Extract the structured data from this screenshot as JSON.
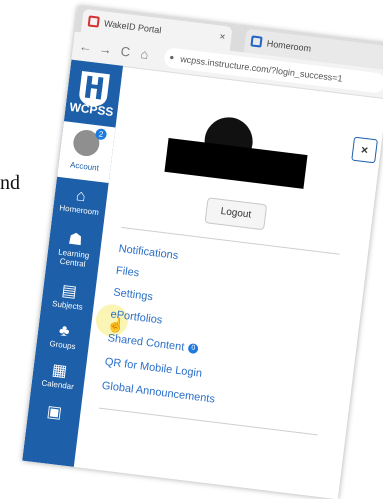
{
  "background_text": "nd",
  "browser": {
    "tabs": [
      {
        "title": "WakeID Portal",
        "close": "×"
      },
      {
        "title": "Homeroom"
      }
    ],
    "nav": {
      "back": "←",
      "forward": "→",
      "reload": "C",
      "home": "⌂"
    },
    "address": "wcpss.instructure.com/?login_success=1"
  },
  "sidebar": {
    "logo_text": "WCPSS",
    "account": {
      "label": "Account",
      "badge": "2"
    },
    "items": [
      {
        "label": "Homeroom",
        "icon": "home-icon",
        "glyph": "⌂"
      },
      {
        "label": "Learning Central",
        "icon": "people-icon",
        "glyph": "☗"
      },
      {
        "label": "Subjects",
        "icon": "book-icon",
        "glyph": "▤"
      },
      {
        "label": "Groups",
        "icon": "groups-icon",
        "glyph": "♣"
      },
      {
        "label": "Calendar",
        "icon": "calendar-icon",
        "glyph": "▦"
      },
      {
        "label": "",
        "icon": "inbox-icon",
        "glyph": "▣"
      }
    ]
  },
  "account_panel": {
    "close": "×",
    "logout_label": "Logout",
    "links": [
      {
        "label": "Notifications"
      },
      {
        "label": "Files"
      },
      {
        "label": "Settings"
      },
      {
        "label": "ePortfolios"
      },
      {
        "label": "Shared Content",
        "badge": "0"
      },
      {
        "label": "QR for Mobile Login"
      },
      {
        "label": "Global Announcements"
      }
    ]
  },
  "colors": {
    "sidebar": "#1d5fa8",
    "link": "#2a6fc9",
    "highlight": "#f5e65a"
  }
}
